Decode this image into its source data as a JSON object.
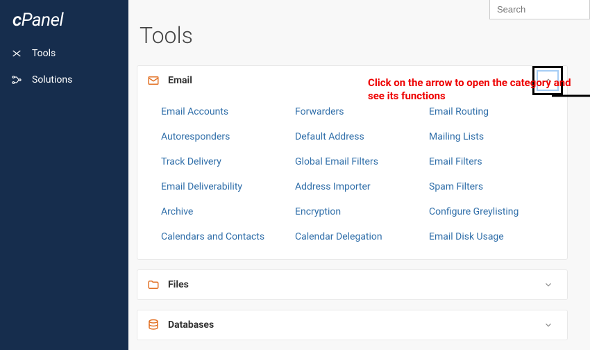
{
  "brand": "cPanel",
  "sidebar": {
    "items": [
      {
        "label": "Tools"
      },
      {
        "label": "Solutions"
      }
    ]
  },
  "search": {
    "placeholder": "Search"
  },
  "heading": "Tools",
  "annotation": "Click on the arrow to open the category and see its functions",
  "categories": [
    {
      "title": "Email",
      "expanded": true,
      "items": [
        "Email Accounts",
        "Forwarders",
        "Email Routing",
        "Autoresponders",
        "Default Address",
        "Mailing Lists",
        "Track Delivery",
        "Global Email Filters",
        "Email Filters",
        "Email Deliverability",
        "Address Importer",
        "Spam Filters",
        "Archive",
        "Encryption",
        "Configure Greylisting",
        "Calendars and Contacts",
        "Calendar Delegation",
        "Email Disk Usage"
      ]
    },
    {
      "title": "Files",
      "expanded": false,
      "items": []
    },
    {
      "title": "Databases",
      "expanded": false,
      "items": []
    }
  ]
}
